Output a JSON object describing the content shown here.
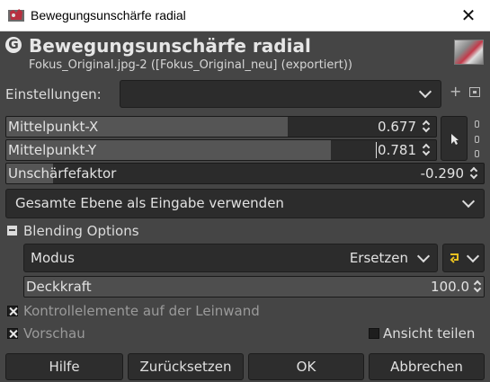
{
  "window": {
    "title": "Bewegungsunschärfe radial"
  },
  "header": {
    "title": "Bewegungsunschärfe radial",
    "subtitle": "Fokus_Original.jpg-2 ([Fokus_Original_neu] (exportiert))",
    "app_icon_letter": "G"
  },
  "presets": {
    "label": "Einstellungen:",
    "value": ""
  },
  "params": {
    "center_x": {
      "label": "Mittelpunkt-X",
      "value": "0.677",
      "fraction": 0.677
    },
    "center_y": {
      "label": "Mittelpunkt-Y",
      "value": "0.781",
      "fraction": 0.781
    },
    "factor": {
      "label": "Unschärfefaktor",
      "value": "-0.290",
      "fraction": 0.0
    }
  },
  "input_mode": {
    "value": "Gesamte Ebene als Eingabe verwenden"
  },
  "blending": {
    "section_label": "Blending Options",
    "mode_label": "Modus",
    "mode_value": "Ersetzen",
    "opacity_label": "Deckkraft",
    "opacity_value": "100.0",
    "opacity_fraction": 1.0
  },
  "options": {
    "canvas_controls": "Kontrollelemente auf der Leinwand",
    "preview": "Vorschau",
    "split_view": "Ansicht teilen"
  },
  "buttons": {
    "help": "Hilfe",
    "reset": "Zurücksetzen",
    "ok": "OK",
    "cancel": "Abbrechen"
  },
  "colors": {
    "accent_icon": "#e8c020",
    "background": "#454545"
  }
}
